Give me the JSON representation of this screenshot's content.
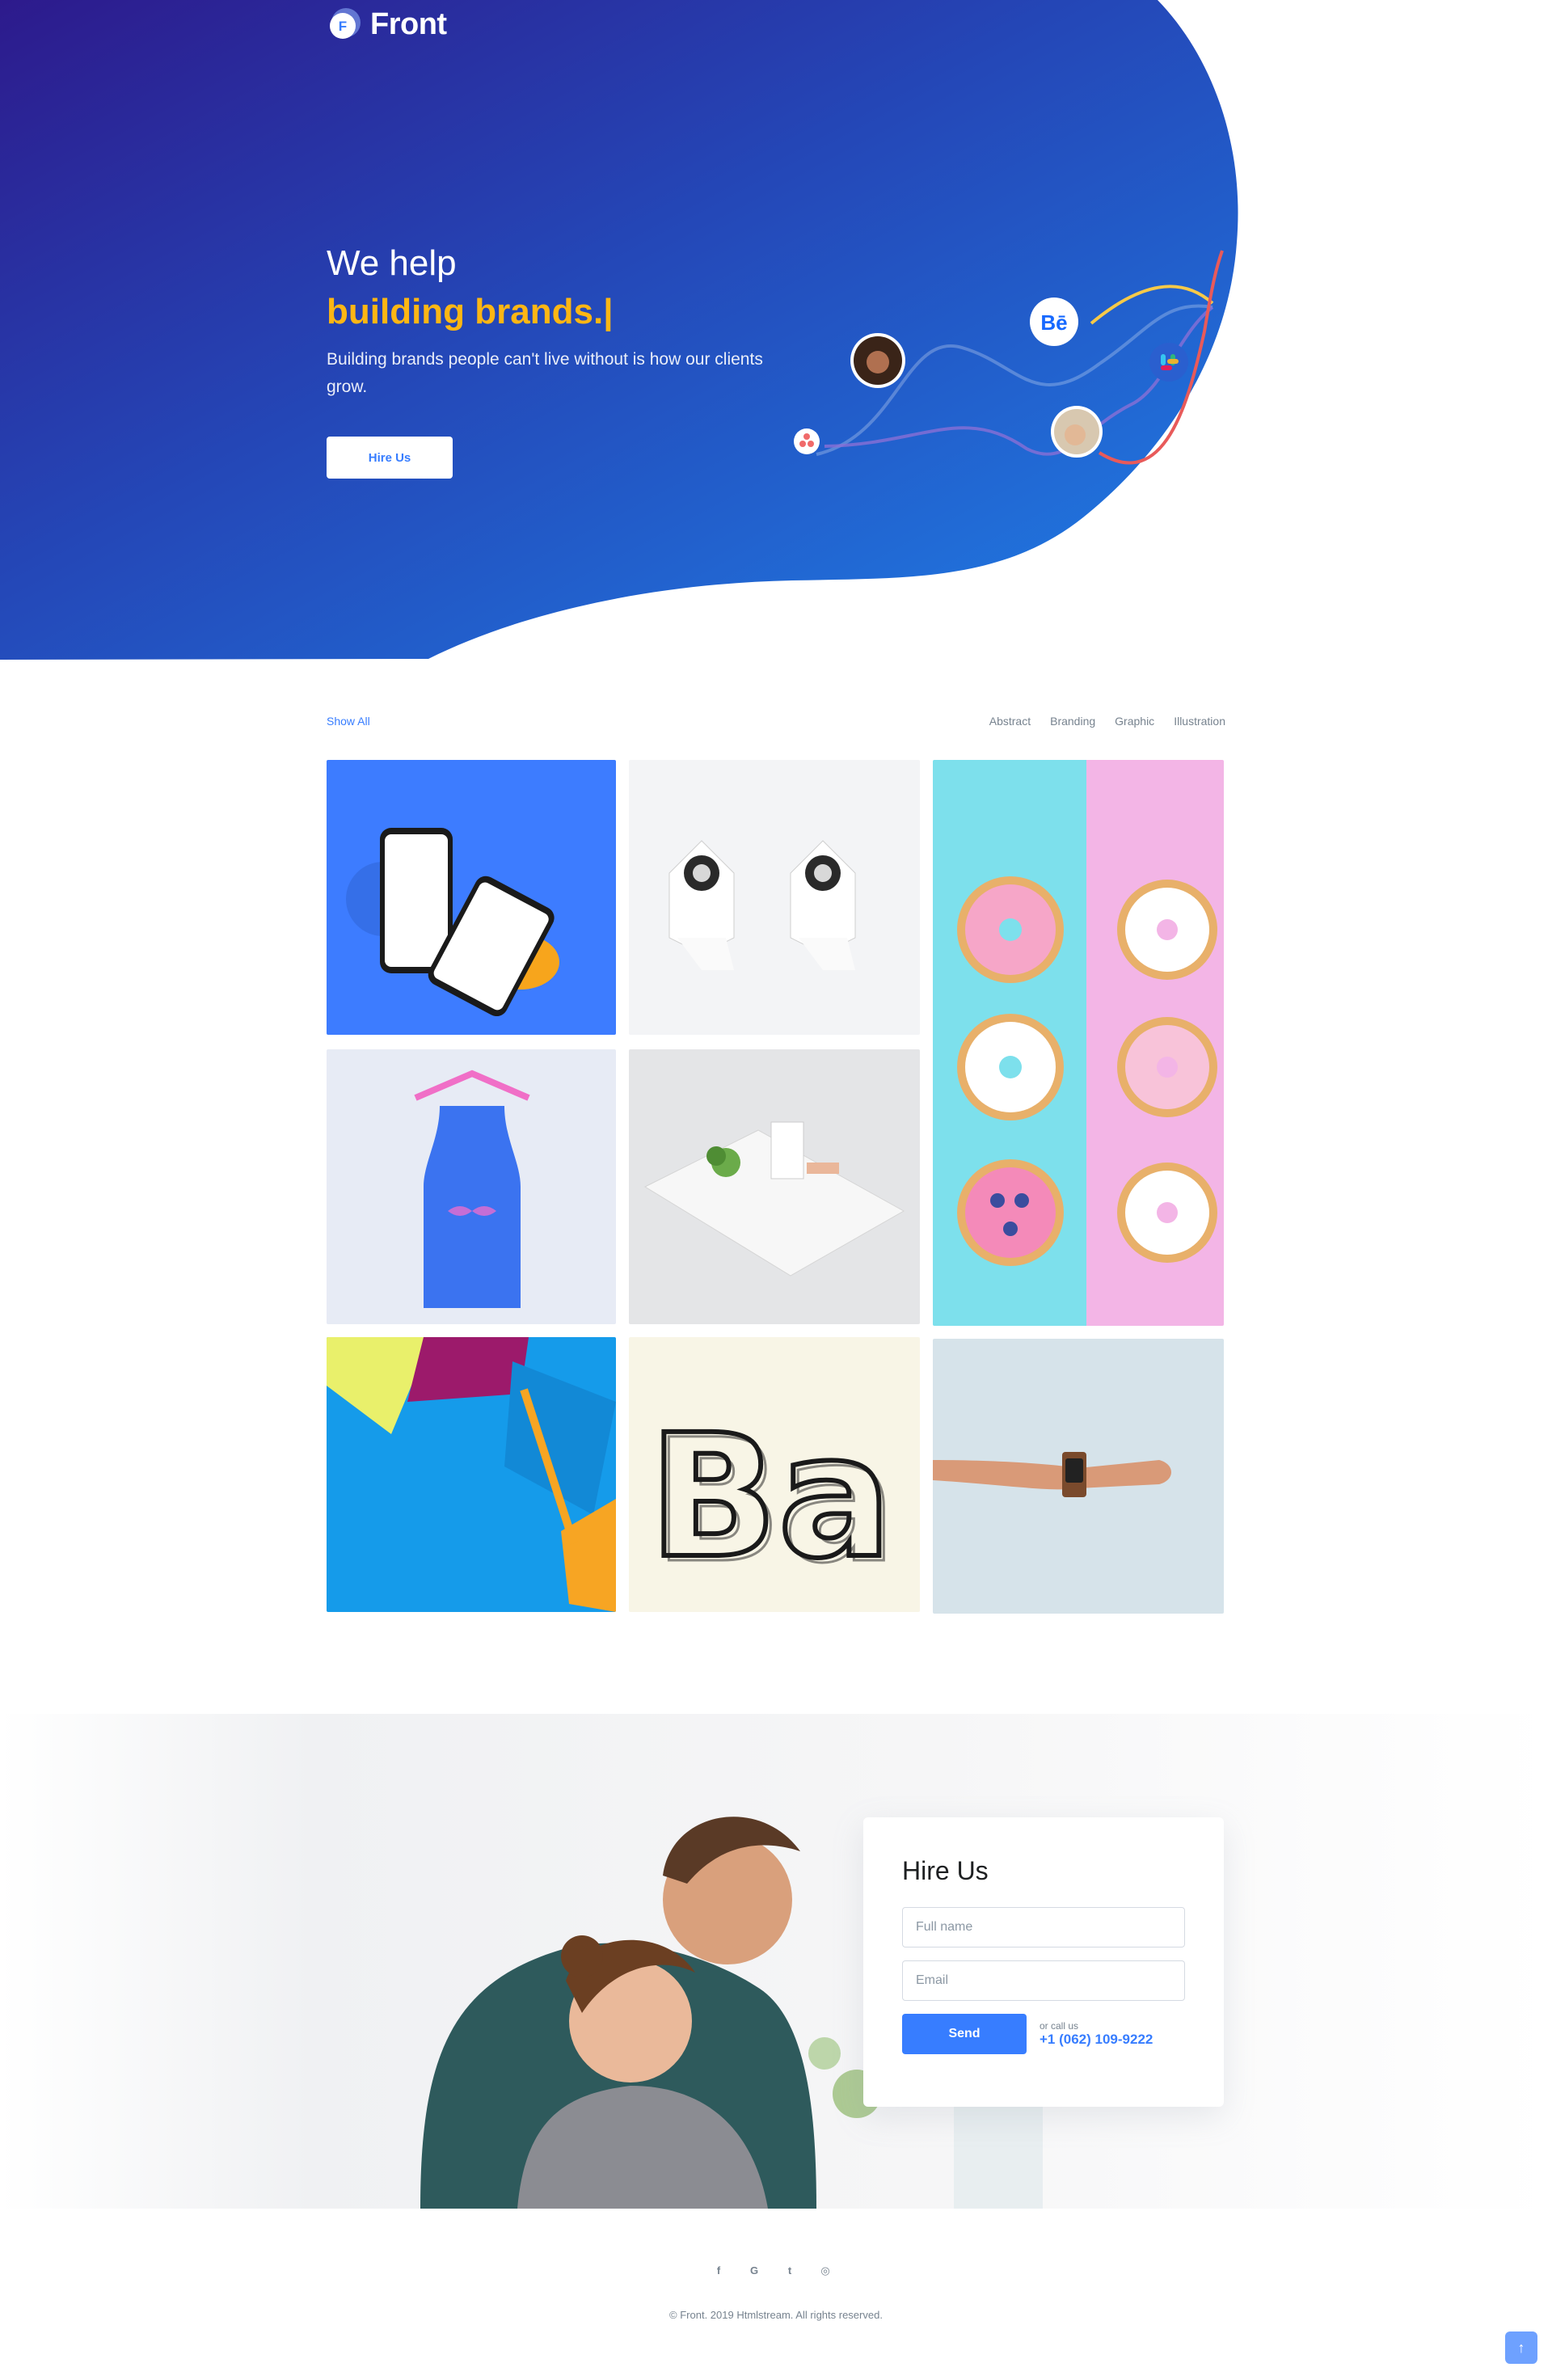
{
  "brand": {
    "name": "Front",
    "logo_letter": "F",
    "accent": "#377dff",
    "highlight": "#fdb614"
  },
  "nav": {
    "menu_icon": "hamburger-icon"
  },
  "hero": {
    "line1": "We help",
    "line2": "building brands.|",
    "subtitle": "Building brands people can't live without is how our clients grow.",
    "cta": "Hire Us",
    "icons": [
      "behance-icon",
      "slack-icon",
      "asana-icon"
    ]
  },
  "portfolio": {
    "show_all": "Show All",
    "filters": [
      "Abstract",
      "Branding",
      "Graphic",
      "Illustration"
    ],
    "tile_ba_text": "Ba"
  },
  "hire": {
    "title": "Hire Us",
    "name_placeholder": "Full name",
    "email_placeholder": "Email",
    "send": "Send",
    "call_label": "or call us",
    "phone": "+1 (062) 109-9222"
  },
  "footer": {
    "socials": [
      "facebook-icon",
      "google-icon",
      "twitter-icon",
      "github-icon"
    ],
    "social_glyphs": [
      "f",
      "G",
      "t",
      "◎"
    ],
    "copyright": "© Front. 2019 Htmlstream. All rights reserved.",
    "to_top": "↑"
  }
}
